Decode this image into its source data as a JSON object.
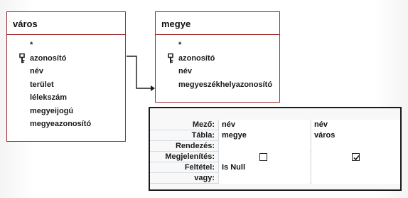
{
  "tables": {
    "varos": {
      "title": "város",
      "fields": [
        {
          "label": "*",
          "key": false
        },
        {
          "label": "azonosító",
          "key": true
        },
        {
          "label": "név",
          "key": false
        },
        {
          "label": "terület",
          "key": false
        },
        {
          "label": "lélekszám",
          "key": false
        },
        {
          "label": "megyeijogú",
          "key": false
        },
        {
          "label": "megyeazonosító",
          "key": false
        }
      ]
    },
    "megye": {
      "title": "megye",
      "fields": [
        {
          "label": "*",
          "key": false
        },
        {
          "label": "azonosító",
          "key": true
        },
        {
          "label": "név",
          "key": false
        },
        {
          "label": "megyeszékhelyazonosító",
          "key": false
        }
      ]
    }
  },
  "query_grid": {
    "row_labels": {
      "field": "Mező:",
      "table": "Tábla:",
      "sort": "Rendezés:",
      "show": "Megjelenítés:",
      "criteria": "Feltétel:",
      "or": "vagy:"
    },
    "columns": [
      {
        "field": "név",
        "table": "megye",
        "sort": "",
        "show": false,
        "criteria": "Is Null",
        "or": ""
      },
      {
        "field": "név",
        "table": "város",
        "sort": "",
        "show": true,
        "criteria": "",
        "or": ""
      }
    ]
  },
  "colors": {
    "table_border": "#9c2a2a",
    "grid_border": "#1a1a1a"
  },
  "icons": {
    "primary_key": "key-icon",
    "relationship": "join-line"
  }
}
